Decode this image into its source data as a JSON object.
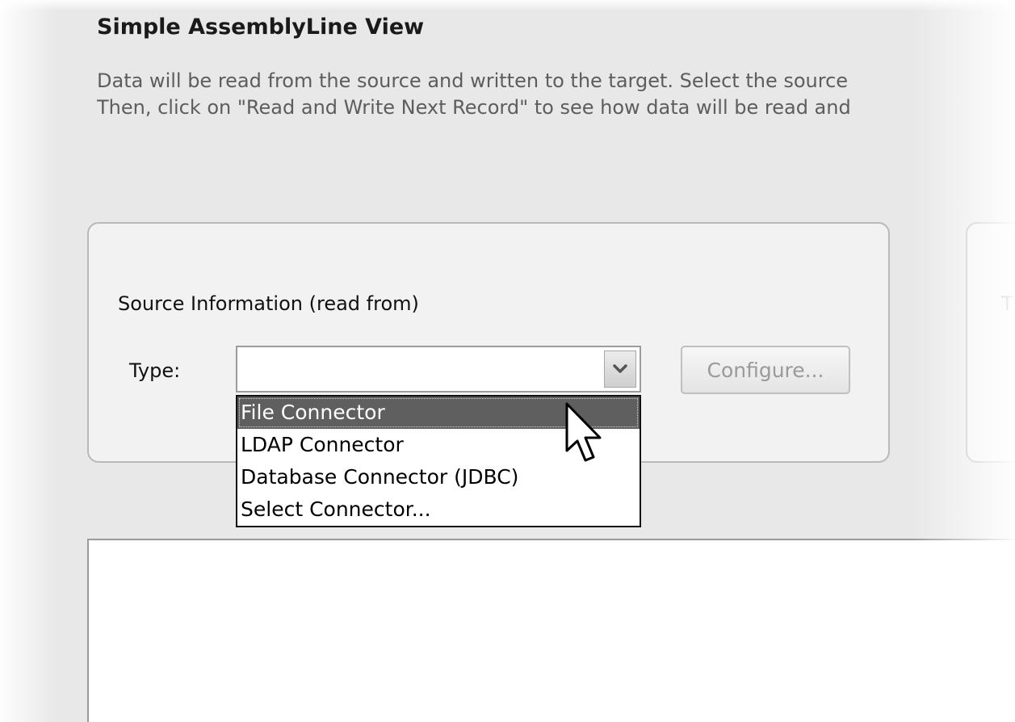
{
  "header": {
    "title": "Simple AssemblyLine View",
    "description_line1": "Data will be read from the source and written to the target. Select the source",
    "description_line2": "Then, click on \"Read and Write Next Record\" to see how data will be read and"
  },
  "source": {
    "group_label": "Source Information (read from)",
    "type_label": "Type:",
    "type_value": "",
    "configure_label": "Configure...",
    "dropdown_options": [
      "File Connector",
      "LDAP Connector",
      "Database Connector (JDBC)",
      "Select Connector..."
    ],
    "highlighted_option": "File Connector"
  },
  "target": {
    "group_label_fragment": "T"
  },
  "icons": {
    "combo_arrow": "chevron-down-icon",
    "cursor": "mouse-pointer-icon"
  }
}
